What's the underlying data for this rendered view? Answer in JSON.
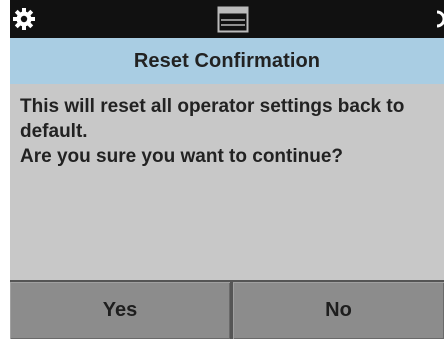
{
  "status_bar": {
    "icons": [
      "gear-icon",
      "window-icon",
      "partial-icon"
    ]
  },
  "dialog": {
    "title": "Reset Confirmation",
    "message_lines": [
      "This will reset all operator settings back to",
      "default.",
      "Are you sure you want to continue?"
    ]
  },
  "buttons": {
    "yes_label": "Yes",
    "no_label": "No"
  },
  "colors": {
    "status_bar": "#111111",
    "title_bar": "#a9cde3",
    "body": "#c8c8c8",
    "button": "#8c8c8c"
  }
}
